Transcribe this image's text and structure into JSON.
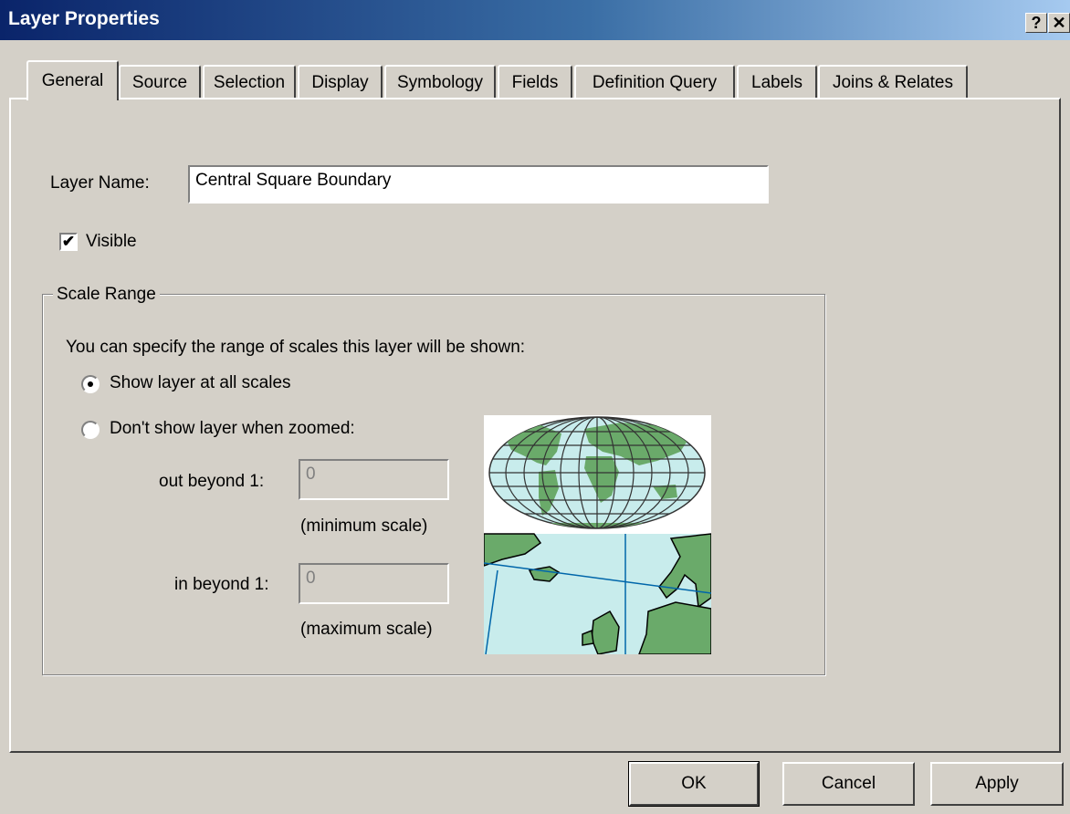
{
  "window": {
    "title": "Layer Properties",
    "help_label": "?",
    "close_label": "✕"
  },
  "tabs": [
    "General",
    "Source",
    "Selection",
    "Display",
    "Symbology",
    "Fields",
    "Definition Query",
    "Labels",
    "Joins & Relates"
  ],
  "general": {
    "layer_name_label": "Layer Name:",
    "layer_name_value": "Central Square Boundary",
    "visible_label": "Visible",
    "visible_checked": true,
    "scale_range": {
      "legend": "Scale Range",
      "description": "You can specify the range of scales this layer will be shown:",
      "option_all": "Show layer at all scales",
      "option_zoomed": "Don't show layer when zoomed:",
      "selected_option": "all",
      "out_beyond_label": "out beyond  1:",
      "out_beyond_value": "0",
      "minimum_scale_label": "(minimum scale)",
      "in_beyond_label": "in beyond  1:",
      "in_beyond_value": "0",
      "maximum_scale_label": "(maximum scale)"
    }
  },
  "buttons": {
    "ok": "OK",
    "cancel": "Cancel",
    "apply": "Apply"
  },
  "colors": {
    "land": "#6aaa6a",
    "ocean": "#c8ecec",
    "title_bar_start": "#0a246a",
    "title_bar_end": "#a6caf0"
  }
}
